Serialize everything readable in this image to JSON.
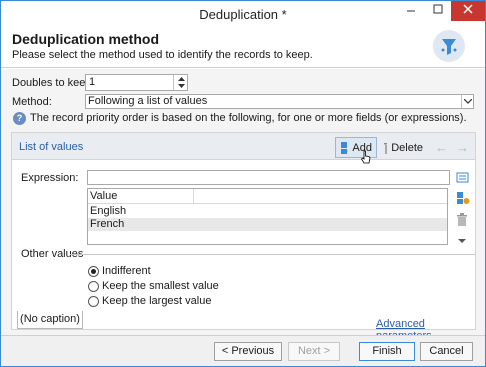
{
  "window": {
    "title": "Deduplication *"
  },
  "header": {
    "title": "Deduplication method",
    "subtitle": "Please select the method used to identify the records to keep."
  },
  "form": {
    "doubles_label": "Doubles to keep:",
    "doubles_value": "1",
    "method_label": "Method:",
    "method_value": "Following a list of values",
    "info_text": "The record priority order is based on the following, for one or more fields (or expressions)."
  },
  "list_panel": {
    "title": "List of values",
    "add_label": "Add",
    "delete_label": "Delete",
    "expression_label": "Expression:",
    "expression_value": "",
    "grid": {
      "column": "Value",
      "rows": [
        "English",
        "French"
      ]
    },
    "other_values_label": "Other values",
    "options": [
      {
        "label": "Indifferent",
        "selected": true
      },
      {
        "label": "Keep the smallest value",
        "selected": false
      },
      {
        "label": "Keep the largest value",
        "selected": false
      }
    ],
    "caption_tab": "(No caption)"
  },
  "advanced_link": "Advanced parameters...",
  "footer": {
    "previous": "< Previous",
    "next": "Next >",
    "finish": "Finish",
    "cancel": "Cancel"
  },
  "colors": {
    "accent": "#3a8ad6",
    "link": "#2a5fa8",
    "close": "#c7372f"
  }
}
